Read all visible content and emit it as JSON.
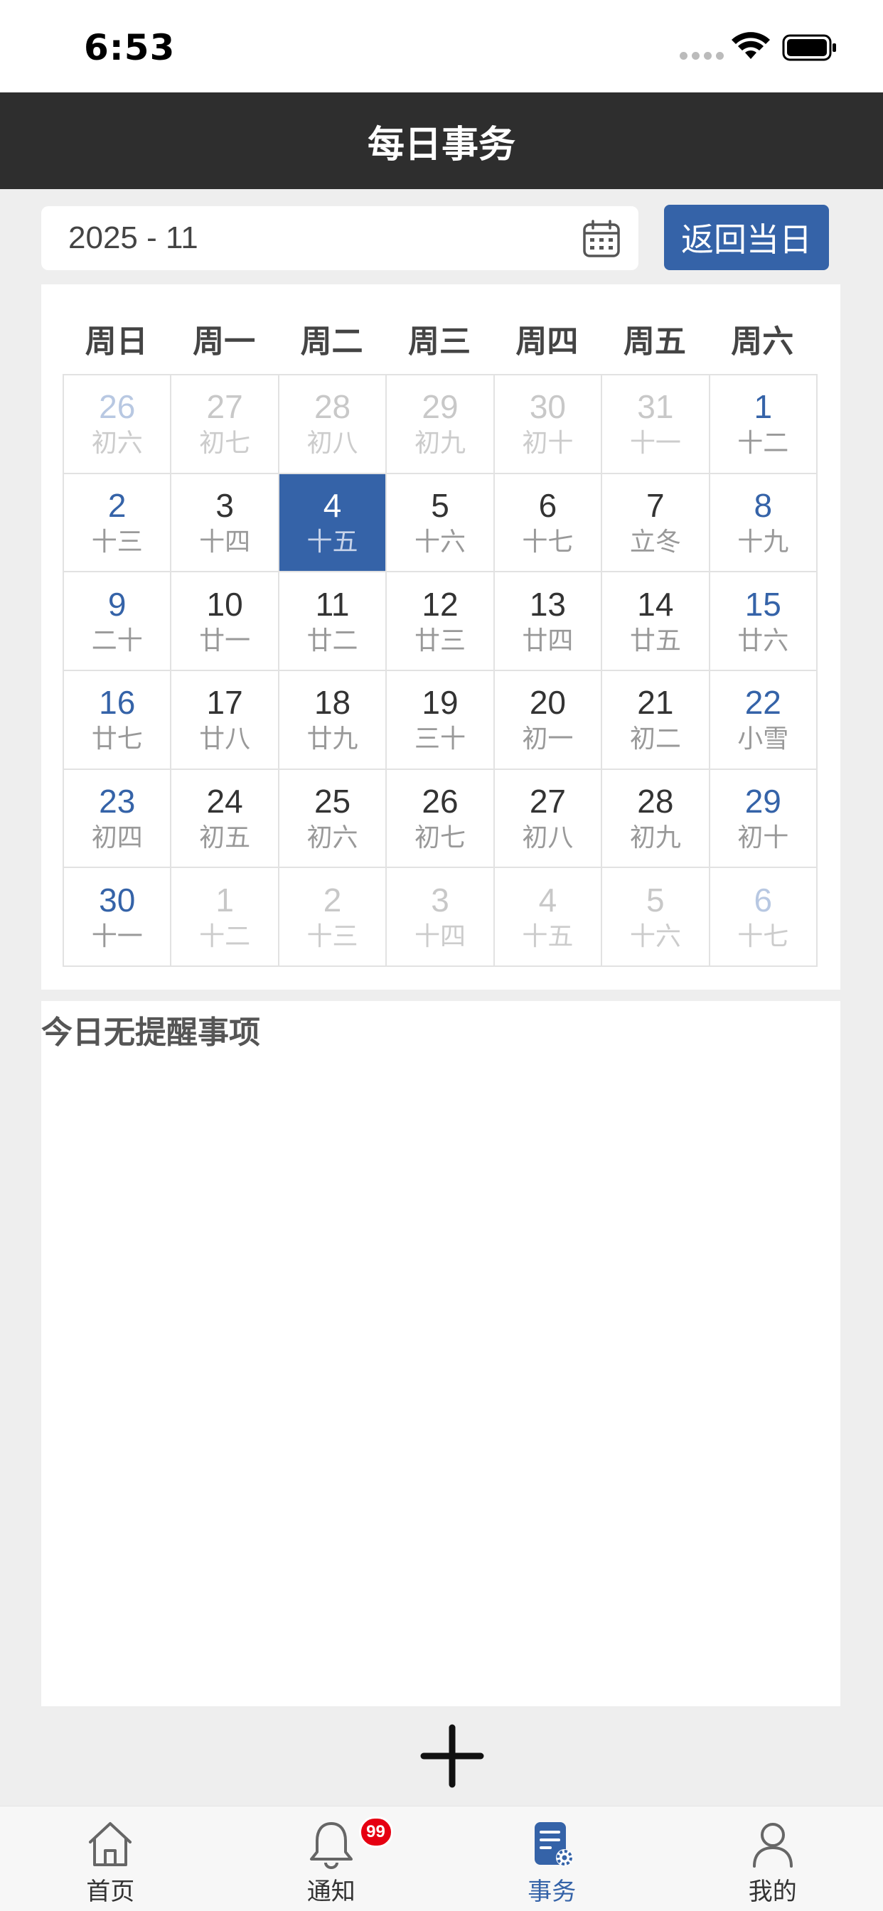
{
  "status_bar": {
    "time": "6:53"
  },
  "header": {
    "title": "每日事务"
  },
  "date_picker": {
    "value": "2025 - 11"
  },
  "today_button": {
    "label": "返回当日"
  },
  "calendar": {
    "weekdays": [
      "周日",
      "周一",
      "周二",
      "周三",
      "周四",
      "周五",
      "周六"
    ],
    "selected_day": "4",
    "days": [
      {
        "n": "26",
        "l": "初六",
        "other": true
      },
      {
        "n": "27",
        "l": "初七",
        "other": true
      },
      {
        "n": "28",
        "l": "初八",
        "other": true
      },
      {
        "n": "29",
        "l": "初九",
        "other": true
      },
      {
        "n": "30",
        "l": "初十",
        "other": true
      },
      {
        "n": "31",
        "l": "十一",
        "other": true
      },
      {
        "n": "1",
        "l": "十二",
        "other": false
      },
      {
        "n": "2",
        "l": "十三",
        "other": false
      },
      {
        "n": "3",
        "l": "十四",
        "other": false
      },
      {
        "n": "4",
        "l": "十五",
        "other": false,
        "selected": true
      },
      {
        "n": "5",
        "l": "十六",
        "other": false
      },
      {
        "n": "6",
        "l": "十七",
        "other": false
      },
      {
        "n": "7",
        "l": "立冬",
        "other": false
      },
      {
        "n": "8",
        "l": "十九",
        "other": false
      },
      {
        "n": "9",
        "l": "二十",
        "other": false
      },
      {
        "n": "10",
        "l": "廿一",
        "other": false
      },
      {
        "n": "11",
        "l": "廿二",
        "other": false
      },
      {
        "n": "12",
        "l": "廿三",
        "other": false
      },
      {
        "n": "13",
        "l": "廿四",
        "other": false
      },
      {
        "n": "14",
        "l": "廿五",
        "other": false
      },
      {
        "n": "15",
        "l": "廿六",
        "other": false
      },
      {
        "n": "16",
        "l": "廿七",
        "other": false
      },
      {
        "n": "17",
        "l": "廿八",
        "other": false
      },
      {
        "n": "18",
        "l": "廿九",
        "other": false
      },
      {
        "n": "19",
        "l": "三十",
        "other": false
      },
      {
        "n": "20",
        "l": "初一",
        "other": false
      },
      {
        "n": "21",
        "l": "初二",
        "other": false
      },
      {
        "n": "22",
        "l": "小雪",
        "other": false
      },
      {
        "n": "23",
        "l": "初四",
        "other": false
      },
      {
        "n": "24",
        "l": "初五",
        "other": false
      },
      {
        "n": "25",
        "l": "初六",
        "other": false
      },
      {
        "n": "26",
        "l": "初七",
        "other": false
      },
      {
        "n": "27",
        "l": "初八",
        "other": false
      },
      {
        "n": "28",
        "l": "初九",
        "other": false
      },
      {
        "n": "29",
        "l": "初十",
        "other": false
      },
      {
        "n": "30",
        "l": "十一",
        "other": false
      },
      {
        "n": "1",
        "l": "十二",
        "other": true
      },
      {
        "n": "2",
        "l": "十三",
        "other": true
      },
      {
        "n": "3",
        "l": "十四",
        "other": true
      },
      {
        "n": "4",
        "l": "十五",
        "other": true
      },
      {
        "n": "5",
        "l": "十六",
        "other": true
      },
      {
        "n": "6",
        "l": "十七",
        "other": true
      }
    ]
  },
  "reminders": {
    "empty_text": "今日无提醒事项"
  },
  "tab_bar": {
    "items": [
      {
        "label": "首页",
        "icon": "home-icon"
      },
      {
        "label": "通知",
        "icon": "bell-icon",
        "badge": "99"
      },
      {
        "label": "事务",
        "icon": "task-icon",
        "active": true
      },
      {
        "label": "我的",
        "icon": "user-icon"
      }
    ]
  },
  "colors": {
    "accent": "#3563a8",
    "nav_bg": "#2e2e2e",
    "badge": "#e60012"
  }
}
